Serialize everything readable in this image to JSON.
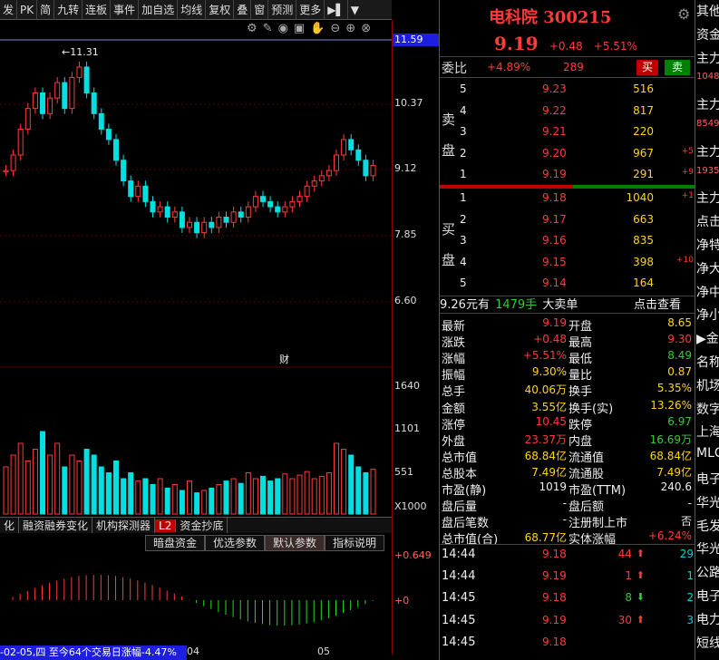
{
  "toolbar": {
    "items": [
      "发",
      "PK",
      "简",
      "九转",
      "连板",
      "事件",
      "加自选",
      "均线",
      "复权",
      "叠",
      "窗",
      "预测",
      "更多"
    ],
    "arrow_label": "▶▌",
    "dropdown": "▼"
  },
  "chart": {
    "axis_labels": [
      "10.37",
      "9.12",
      "7.85",
      "6.60"
    ],
    "current_price_tag": "11.59",
    "high_marker": "11.31",
    "vol_labels": [
      "1640",
      "1101",
      "551"
    ],
    "vol_unit": "X1000",
    "finance_marker": "财",
    "bottom_tabs": [
      "化",
      "融资融券变化",
      "机构探测器",
      "L2",
      "资金抄底"
    ],
    "param_tabs": [
      "暗盘资金",
      "优选参数",
      "默认参数",
      "指标说明"
    ],
    "macd_labels": [
      "+0.649",
      "+0"
    ],
    "status_text": "-02-05,四 至今64个交易日涨幅-4.47%",
    "x_labels": [
      "04",
      "05"
    ]
  },
  "quote": {
    "name": "电科院 300215",
    "price": "9.19",
    "change": "+0.48",
    "change_pct": "+5.51%",
    "weibi_label": "委比",
    "weibi_value": "+4.89%",
    "weicha": "289",
    "buy_btn": "买",
    "sell_btn": "卖",
    "sell_label": [
      "卖",
      "盘"
    ],
    "buy_label": [
      "买",
      "盘"
    ],
    "asks": [
      {
        "level": "5",
        "price": "9.23",
        "vol": "516",
        "chg": ""
      },
      {
        "level": "4",
        "price": "9.22",
        "vol": "817",
        "chg": ""
      },
      {
        "level": "3",
        "price": "9.21",
        "vol": "220",
        "chg": ""
      },
      {
        "level": "2",
        "price": "9.20",
        "vol": "967",
        "chg": "+5"
      },
      {
        "level": "1",
        "price": "9.19",
        "vol": "291",
        "chg": "+9"
      }
    ],
    "bids": [
      {
        "level": "1",
        "price": "9.18",
        "vol": "1040",
        "chg": "+1"
      },
      {
        "level": "2",
        "price": "9.17",
        "vol": "663",
        "chg": ""
      },
      {
        "level": "3",
        "price": "9.16",
        "vol": "835",
        "chg": ""
      },
      {
        "level": "4",
        "price": "9.15",
        "vol": "398",
        "chg": "+10"
      },
      {
        "level": "5",
        "price": "9.14",
        "vol": "164",
        "chg": ""
      }
    ],
    "big_order": {
      "amount": "9.26元有",
      "vol": "1479手",
      "label": "大卖单",
      "link": "点击查看"
    },
    "stats": [
      {
        "l": "最新",
        "v": "9.19",
        "vc": "red",
        "l2": "开盘",
        "v2": "8.65",
        "v2c": "yellow"
      },
      {
        "l": "涨跌",
        "v": "+0.48",
        "vc": "red",
        "l2": "最高",
        "v2": "9.30",
        "v2c": "red"
      },
      {
        "l": "涨幅",
        "v": "+5.51%",
        "vc": "red",
        "l2": "最低",
        "v2": "8.49",
        "v2c": "green"
      },
      {
        "l": "振幅",
        "v": "9.30%",
        "vc": "yellow",
        "l2": "量比",
        "v2": "0.87",
        "v2c": "yellow"
      },
      {
        "l": "总手",
        "v": "40.06万",
        "vc": "yellow",
        "l2": "换手",
        "v2": "5.35%",
        "v2c": "yellow"
      },
      {
        "l": "金额",
        "v": "3.55亿",
        "vc": "yellow",
        "l2": "换手(实)",
        "v2": "13.26%",
        "v2c": "yellow"
      },
      {
        "l": "涨停",
        "v": "10.45",
        "vc": "red",
        "l2": "跌停",
        "v2": "6.97",
        "v2c": "green"
      },
      {
        "l": "外盘",
        "v": "23.37万",
        "vc": "red",
        "l2": "内盘",
        "v2": "16.69万",
        "v2c": "green"
      },
      {
        "l": "总市值",
        "v": "68.84亿",
        "vc": "yellow",
        "l2": "流通值",
        "v2": "68.84亿",
        "v2c": "yellow"
      },
      {
        "l": "总股本",
        "v": "7.49亿",
        "vc": "yellow",
        "l2": "流通股",
        "v2": "7.49亿",
        "v2c": "yellow"
      },
      {
        "l": "市盈(静)",
        "v": "1019",
        "vc": "white",
        "l2": "市盈(TTM)",
        "v2": "240.6",
        "v2c": "white"
      },
      {
        "l": "盘后量",
        "v": "-",
        "vc": "white",
        "l2": "盘后额",
        "v2": "-",
        "v2c": "white"
      },
      {
        "l": "盘后笔数",
        "v": "-",
        "vc": "white",
        "l2": "注册制上市",
        "v2": "否",
        "v2c": "white"
      },
      {
        "l": "总市值(合)",
        "v": "68.77亿",
        "vc": "yellow",
        "l2": "实体涨幅",
        "v2": "+6.24%",
        "v2c": "red"
      }
    ],
    "ticks": [
      {
        "time": "14:44",
        "price": "9.18",
        "vol": "44",
        "dir": "up",
        "n": "29"
      },
      {
        "time": "14:44",
        "price": "9.19",
        "vol": "1",
        "dir": "up",
        "n": "1"
      },
      {
        "time": "14:45",
        "price": "9.18",
        "vol": "8",
        "dir": "down",
        "n": "2"
      },
      {
        "time": "14:45",
        "price": "9.19",
        "vol": "30",
        "dir": "up",
        "n": "3"
      },
      {
        "time": "14:45",
        "price": "9.18",
        "vol": "",
        "dir": "",
        "n": ""
      }
    ]
  },
  "sidebar": {
    "items": [
      "其他",
      "资金",
      "主力",
      "1048",
      "主力",
      "8549",
      "主力",
      "1935",
      "主力",
      "点击",
      "净特",
      "净大",
      "净中",
      "净小",
      "▶金",
      "名称",
      "机场",
      "数字",
      "上海",
      "MLC",
      "电子",
      "华光",
      "毛发",
      "华光",
      "公路",
      "电子",
      "电力",
      "短线"
    ]
  }
}
